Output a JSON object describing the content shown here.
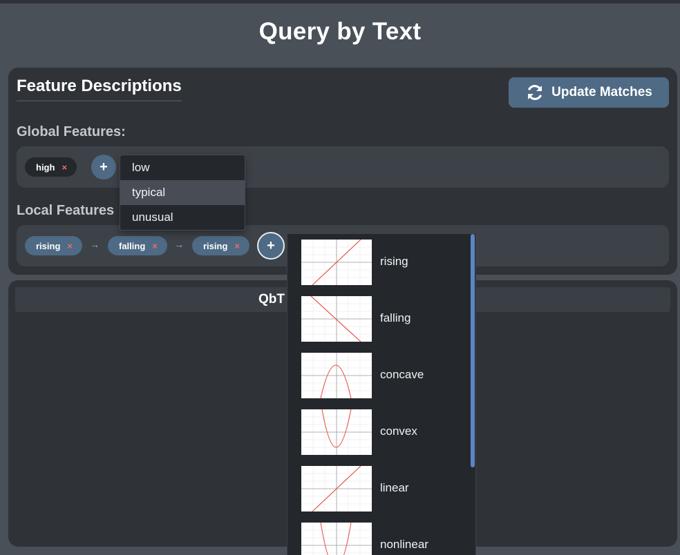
{
  "page": {
    "title": "Query by Text"
  },
  "panel": {
    "title": "Feature Descriptions",
    "update_button": "Update Matches",
    "global_label": "Global Features:",
    "local_label": "Local Features",
    "global_chips": [
      {
        "label": "high",
        "remove": "×"
      }
    ],
    "local_chips": [
      {
        "label": "rising",
        "remove": "×"
      },
      {
        "label": "falling",
        "remove": "×"
      },
      {
        "label": "rising",
        "remove": "×"
      }
    ],
    "arrow": "→",
    "add_symbol": "+"
  },
  "global_dropdown": {
    "options": [
      "low",
      "typical",
      "unusual"
    ],
    "highlighted": "typical"
  },
  "bottom_panel": {
    "header": "QbT"
  },
  "local_feature_popup": {
    "items": [
      {
        "label": "rising",
        "icon": "line-up-plot-icon"
      },
      {
        "label": "falling",
        "icon": "line-down-plot-icon"
      },
      {
        "label": "concave",
        "icon": "concave-plot-icon"
      },
      {
        "label": "convex",
        "icon": "convex-plot-icon"
      },
      {
        "label": "linear",
        "icon": "linear-plot-icon"
      },
      {
        "label": "nonlinear",
        "icon": "nonlinear-plot-icon"
      }
    ]
  },
  "colors": {
    "background": "#4a5058",
    "panel": "#2f3338",
    "accent_blue": "#4e6a85",
    "remove_x": "#f26a6a",
    "plot_line": "#e8443a",
    "scrollbar": "#5b85c6"
  }
}
